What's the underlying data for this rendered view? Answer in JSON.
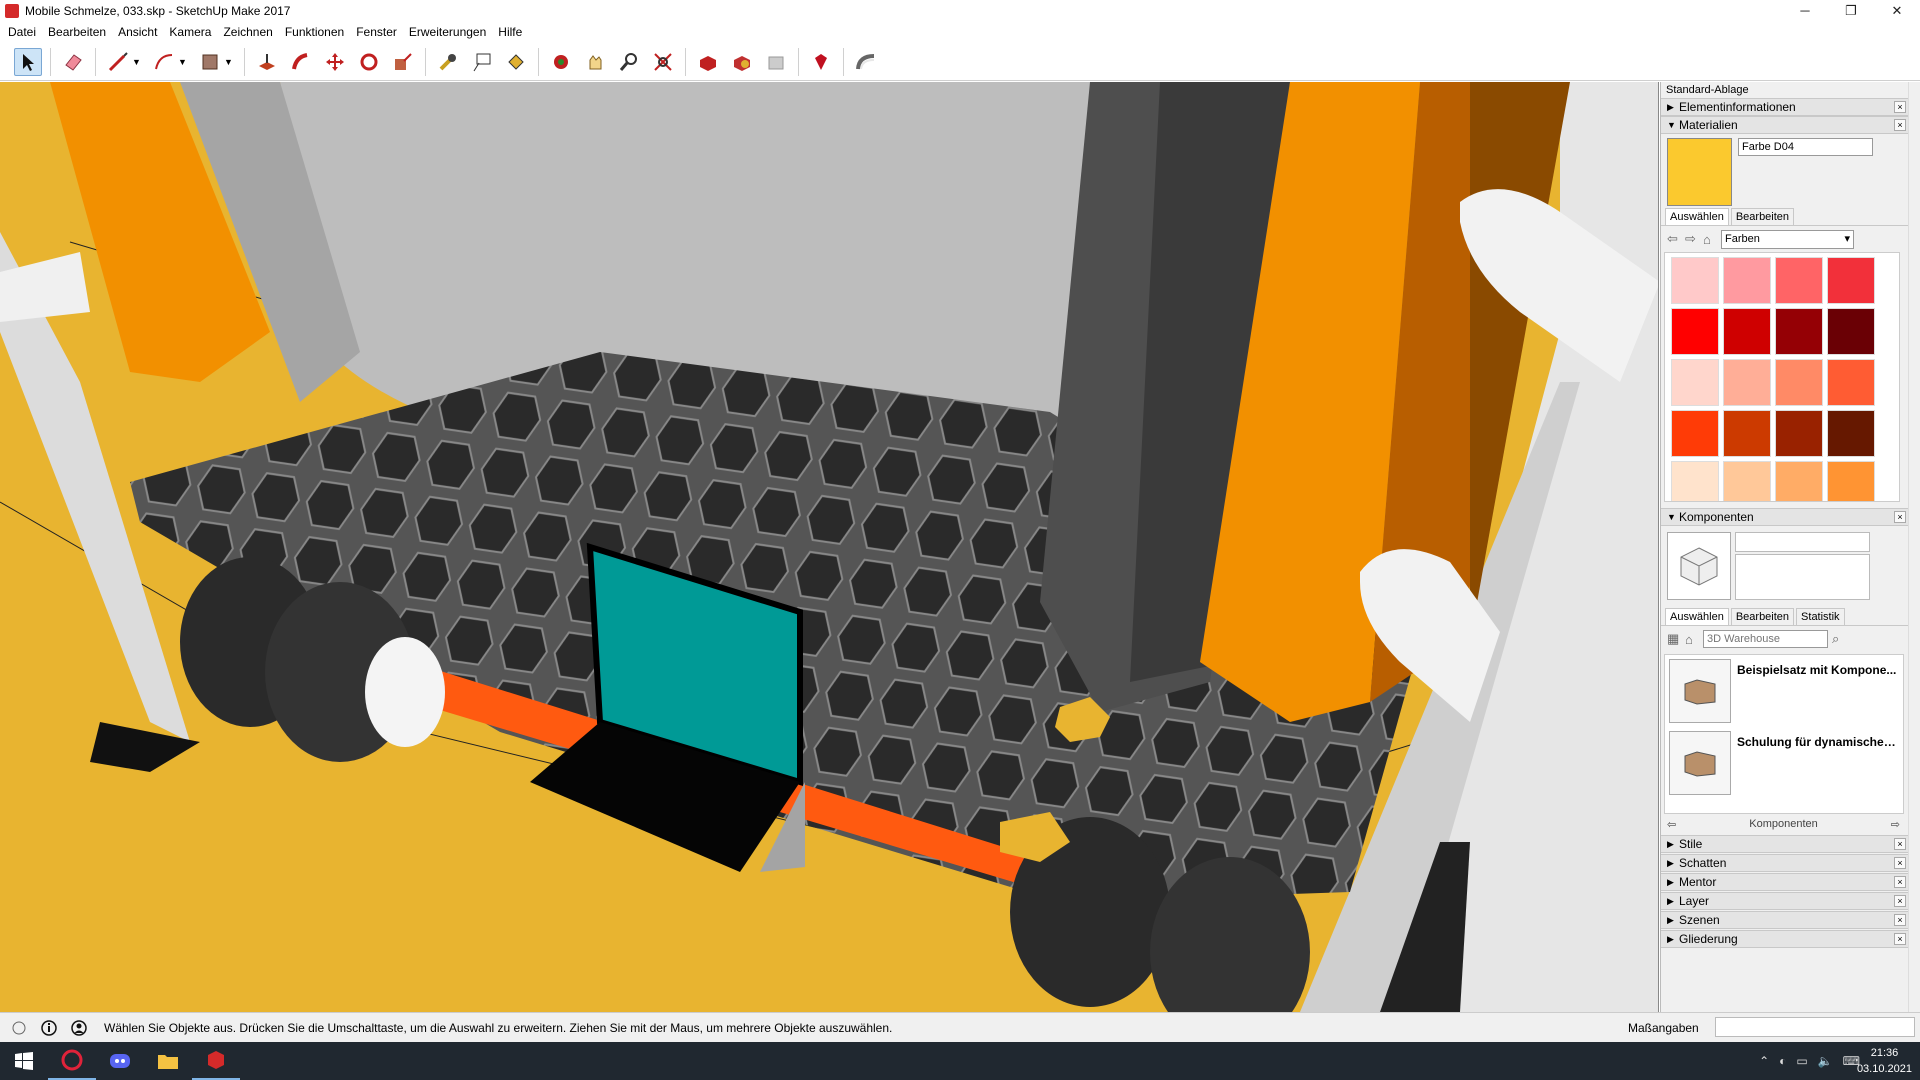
{
  "window": {
    "title": "Mobile Schmelze, 033.skp - SketchUp Make 2017",
    "minimize": "─",
    "maximize": "❐",
    "close": "✕"
  },
  "menu": [
    "Datei",
    "Bearbeiten",
    "Ansicht",
    "Kamera",
    "Zeichnen",
    "Funktionen",
    "Fenster",
    "Erweiterungen",
    "Hilfe"
  ],
  "toolbar": {
    "tools": [
      "select-tool",
      "eraser-tool",
      "line-tool",
      "arc-tool",
      "shape-tool",
      "push-pull-tool",
      "follow-me-tool",
      "move-tool",
      "rotate-tool",
      "scale-tool",
      "tape-measure-tool",
      "text-tool",
      "paint-bucket-tool",
      "orbit-tool",
      "pan-tool",
      "zoom-tool",
      "zoom-extents-tool",
      "3d-warehouse-tool",
      "extension-warehouse-tool",
      "share-model-tool",
      "ruby-tool",
      "styles-tool"
    ]
  },
  "tray": {
    "title": "Standard-Ablage",
    "panels": {
      "entity_info": "Elementinformationen",
      "materials": "Materialien",
      "components": "Komponenten"
    },
    "materials": {
      "name": "Farbe D04",
      "current_color": "#fbc92e",
      "tab_select": "Auswählen",
      "tab_edit": "Bearbeiten",
      "library": "Farben",
      "swatches": [
        "#ffc9c9",
        "#ff9aa0",
        "#ff6466",
        "#f2303a",
        "#ff0000",
        "#cf0000",
        "#950005",
        "#6a0005",
        "#ffd6cc",
        "#ffae97",
        "#ff8a66",
        "#ff5c33",
        "#ff3b06",
        "#cc3a00",
        "#992200",
        "#661800",
        "#ffe3cc",
        "#ffc899",
        "#ffac66",
        "#ff9433"
      ]
    },
    "components": {
      "tab_select": "Auswählen",
      "tab_edit": "Bearbeiten",
      "tab_stats": "Statistik",
      "search_placeholder": "3D Warehouse",
      "items": [
        "Beispielsatz mit Kompone...",
        "Schulung für dynamische ..."
      ],
      "footer": "Komponenten"
    },
    "collapsed": [
      "Stile",
      "Schatten",
      "Mentor",
      "Layer",
      "Szenen",
      "Gliederung"
    ]
  },
  "status": {
    "message": "Wählen Sie Objekte aus. Drücken Sie die Umschalttaste, um die Auswahl zu erweitern. Ziehen Sie mit der Maus, um mehrere Objekte auszuwählen.",
    "measure_label": "Maßangaben"
  },
  "taskbar": {
    "time": "21:36",
    "date": "03.10.2021"
  }
}
